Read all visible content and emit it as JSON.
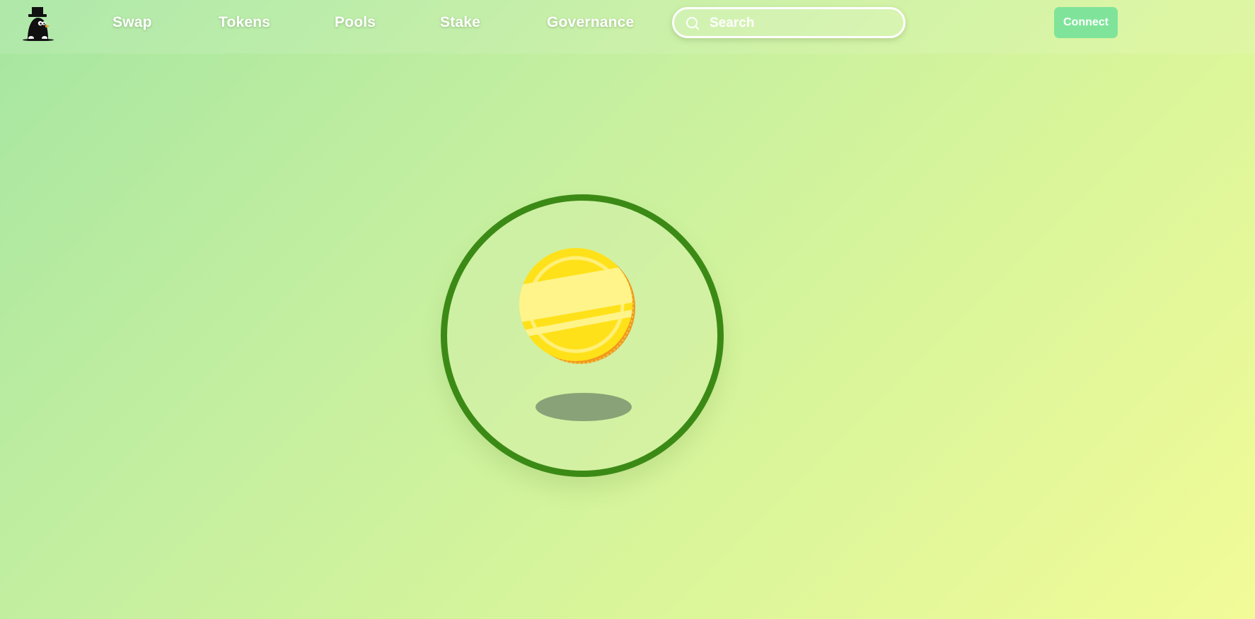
{
  "app": {
    "logo_icon": "mole-top-hat-icon"
  },
  "nav": {
    "items": [
      {
        "label": "Swap"
      },
      {
        "label": "Tokens"
      },
      {
        "label": "Pools"
      },
      {
        "label": "Stake"
      },
      {
        "label": "Governance"
      }
    ]
  },
  "search": {
    "placeholder": "Search",
    "value": "",
    "icon": "search-icon"
  },
  "header": {
    "connect_label": "Connect"
  },
  "loader": {
    "icon": "spinning-coin-icon"
  },
  "colors": {
    "ring": "#3c8a16",
    "coin": "#ffe11a",
    "connect_button": "#7fe49a"
  }
}
